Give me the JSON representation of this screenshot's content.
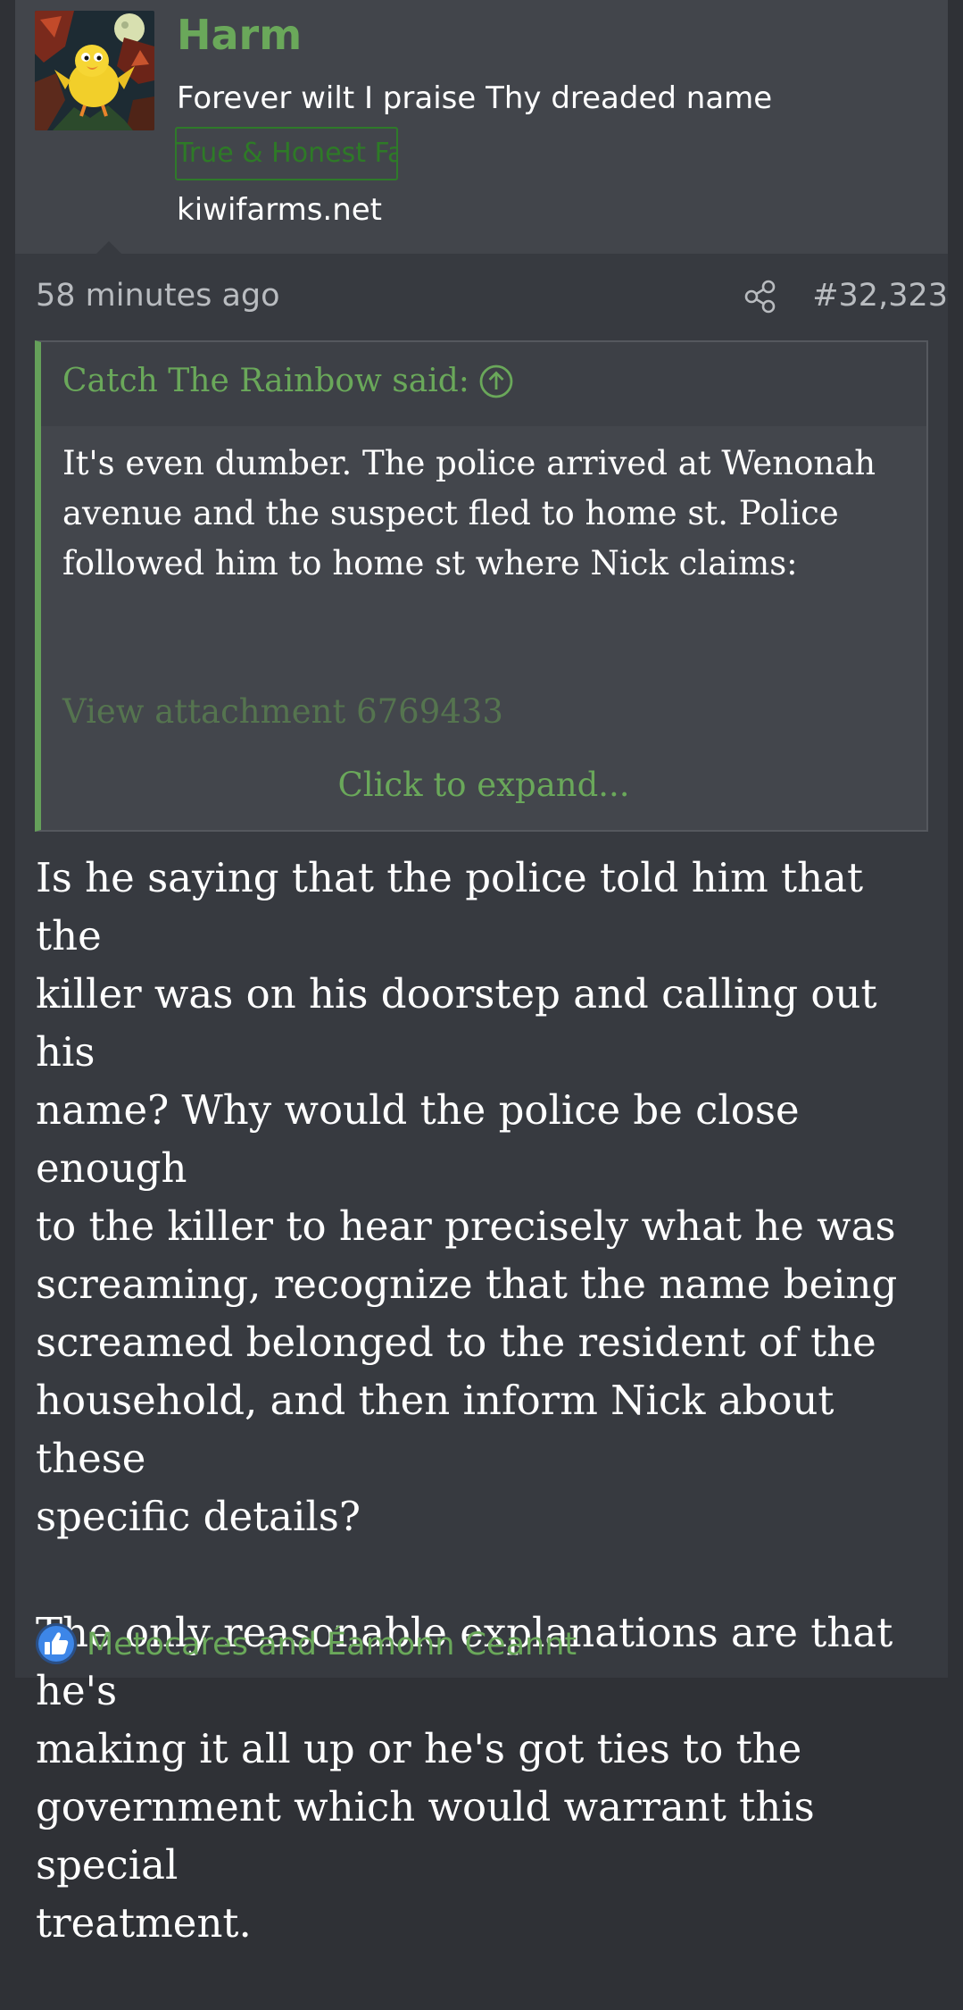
{
  "user": {
    "name": "Harm",
    "title": "Forever wilt I praise Thy dreaded name",
    "banner": "True & Honest Fan",
    "site": "kiwifarms.net"
  },
  "meta": {
    "time": "58 minutes ago",
    "post_number": "#32,323"
  },
  "quote": {
    "author": "Catch The Rainbow said:",
    "lines": [
      "It's even dumber. The police arrived at Wenonah",
      "avenue and the suspect fled to home st. Police",
      "followed him to home st where Nick claims:"
    ],
    "attachment": "View attachment 6769433",
    "expand": "Click to expand..."
  },
  "body": {
    "paragraph1": [
      "Is he saying that the police told him that the",
      "killer was on his doorstep and calling out his",
      "name? Why would the police be close enough",
      "to the killer to hear precisely what he was",
      "screaming, recognize that the name being",
      "screamed belonged to the resident of the",
      "household, and then inform Nick about these",
      "specific details?"
    ],
    "paragraph2": [
      "The only reasonable explanations are that he's",
      "making it all up or he's got ties to the",
      "government which would warrant this special",
      "treatment."
    ]
  },
  "reactions": {
    "icon": "like-icon",
    "users": "Metocares and Éamonn Ceannt"
  },
  "colors": {
    "accent": "#6aa85a",
    "page_bg": "#2f3136",
    "post_bg": "#373a40",
    "user_block_bg": "#42454b",
    "quote_bg": "#43464c",
    "banner_text": "#2e7a27"
  }
}
